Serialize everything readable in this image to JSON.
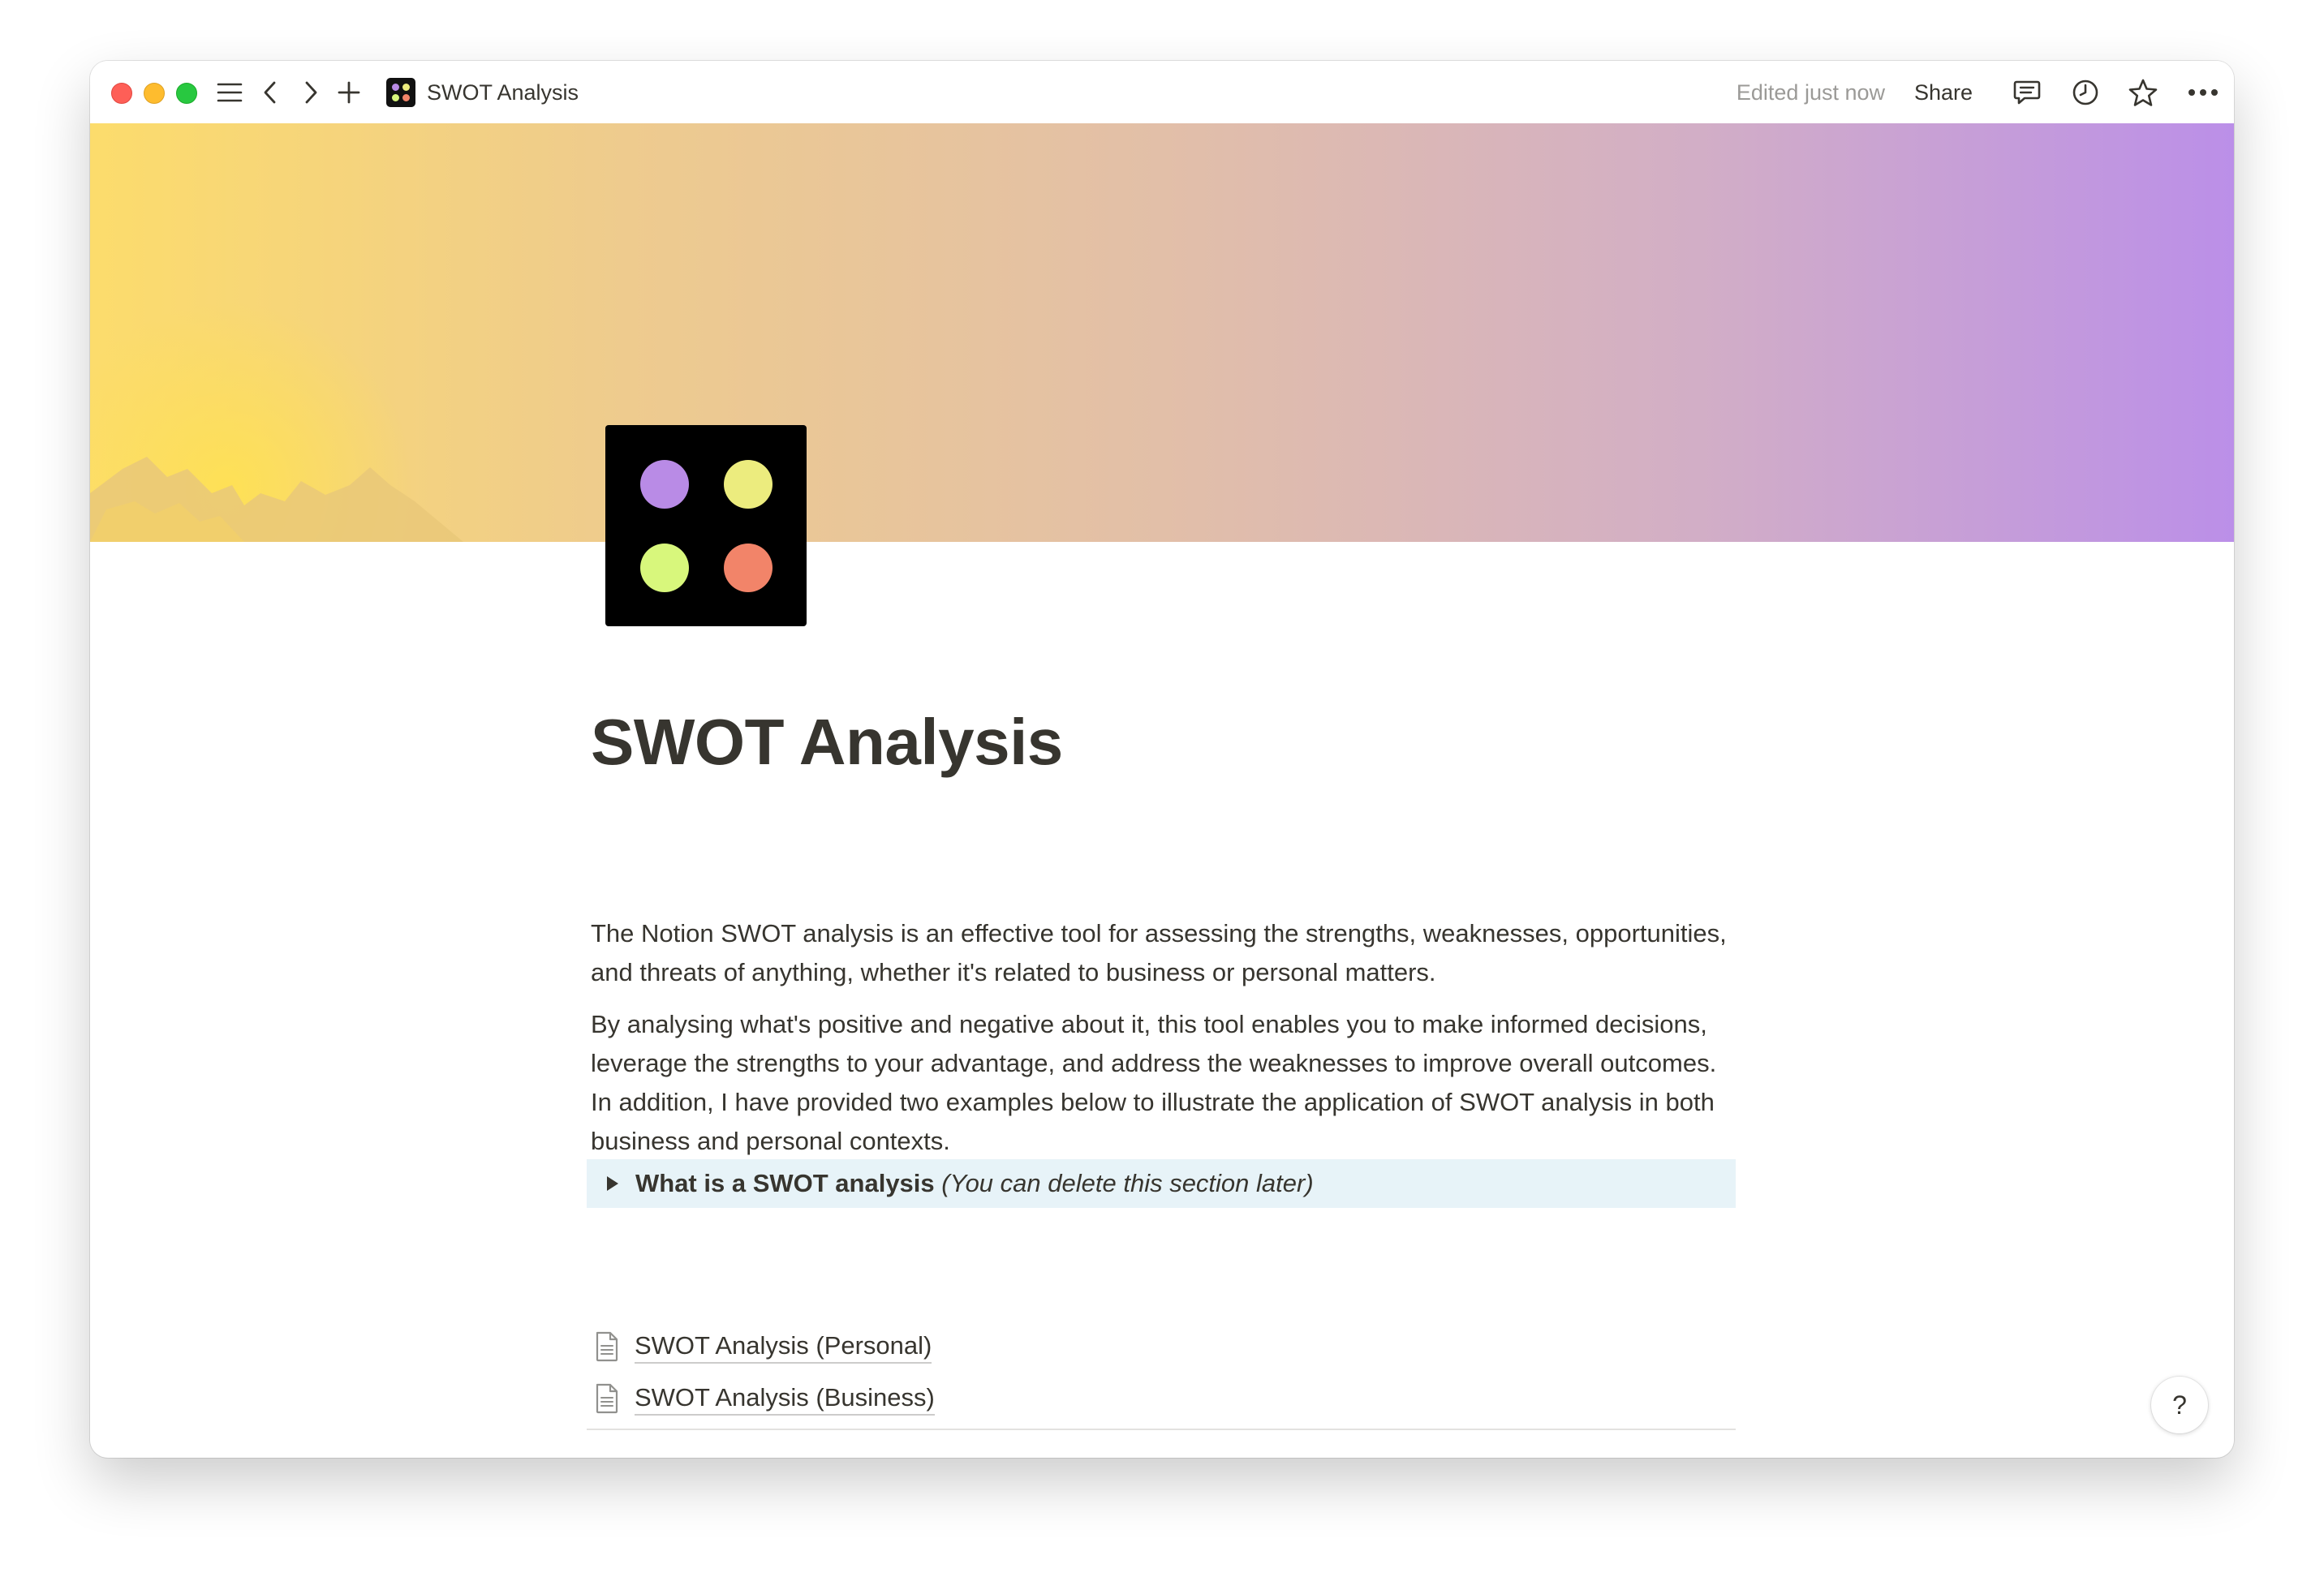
{
  "titlebar": {
    "tab_title": "SWOT Analysis",
    "edited_label": "Edited just now",
    "share_label": "Share",
    "traffic_colors": [
      "#fe5f57",
      "#febc2e",
      "#28c840"
    ]
  },
  "cover": {
    "gradient_start": "#fcdc6c",
    "gradient_end": "#bb8fe8"
  },
  "page_icon": {
    "background": "#000000",
    "dot_colors": [
      "#b98be6",
      "#ecec7e",
      "#d8f77c",
      "#f28469"
    ]
  },
  "page": {
    "title": "SWOT Analysis",
    "paragraphs": [
      "The Notion SWOT analysis is an effective tool for assessing the strengths, weaknesses, opportunities, and threats of anything, whether it's related to business or personal matters.",
      "By analysing what's positive and negative about it, this tool enables you to make informed decisions, leverage the strengths to your advantage, and address the weaknesses to improve overall outcomes. In addition, I have provided two examples below to illustrate the application of SWOT analysis in both business and personal contexts."
    ],
    "toggle": {
      "bold_text": "What is a SWOT analysis",
      "italic_text": "(You can delete this section later)",
      "background": "#e7f3f8"
    },
    "links": [
      "SWOT Analysis (Personal)",
      "SWOT Analysis (Business)"
    ]
  },
  "help": {
    "label": "?"
  },
  "icons": {
    "sidebar": "menu-icon",
    "back": "chevron-left-icon",
    "forward": "chevron-right-icon",
    "new": "plus-icon",
    "comments": "comment-icon",
    "updates": "clock-icon",
    "favorite": "star-icon",
    "more": "more-dots-icon",
    "page_link": "document-icon",
    "toggle": "triangle-right-icon"
  }
}
